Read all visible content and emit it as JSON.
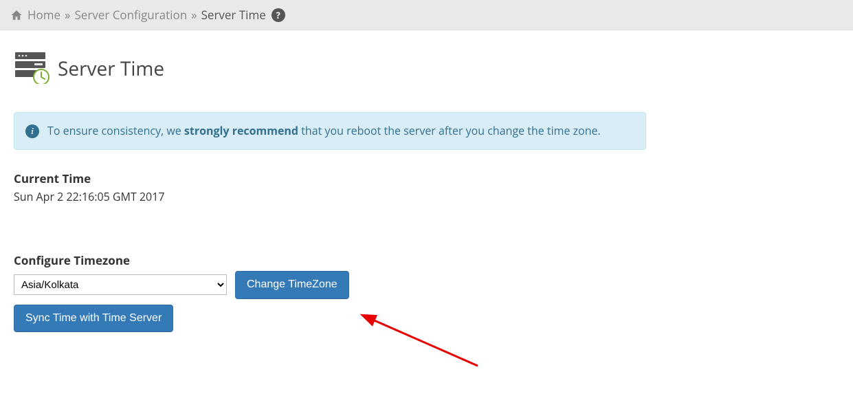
{
  "breadcrumb": {
    "home": "Home",
    "sep": "»",
    "server_config": "Server Configuration",
    "current": "Server Time"
  },
  "page": {
    "title": "Server Time"
  },
  "alert": {
    "prefix": "To ensure consistency, we ",
    "strong": "strongly recommend",
    "suffix": " that you reboot the server after you change the time zone."
  },
  "current_time": {
    "label": "Current Time",
    "value": "Sun Apr 2 22:16:05 GMT 2017"
  },
  "timezone": {
    "label": "Configure Timezone",
    "selected": "Asia/Kolkata",
    "change_btn": "Change TimeZone",
    "sync_btn": "Sync Time with Time Server"
  }
}
